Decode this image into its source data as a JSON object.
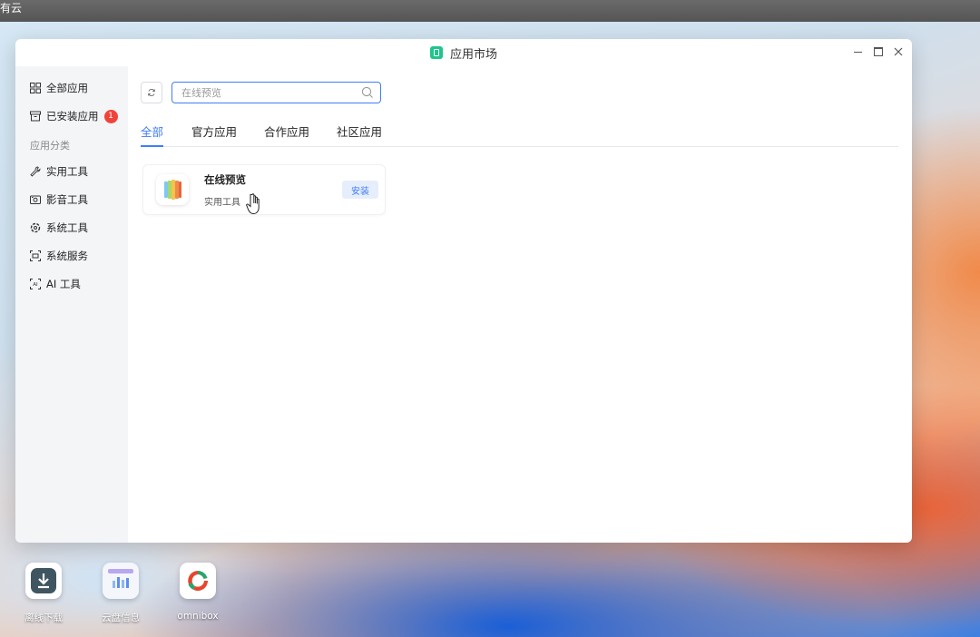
{
  "desktop": {
    "topbar_text": "有云",
    "icons": [
      {
        "label": "离线下载"
      },
      {
        "label": "云盘信息"
      },
      {
        "label": "omnibox"
      }
    ]
  },
  "window": {
    "title": "应用市场"
  },
  "sidebar": {
    "all_apps": "全部应用",
    "installed": "已安装应用",
    "installed_count": "1",
    "category_header": "应用分类",
    "categories": [
      {
        "label": "实用工具",
        "icon": "wrench-icon"
      },
      {
        "label": "影音工具",
        "icon": "media-icon"
      },
      {
        "label": "系统工具",
        "icon": "system-icon"
      },
      {
        "label": "系统服务",
        "icon": "service-icon"
      },
      {
        "label": "AI 工具",
        "icon": "ai-icon"
      }
    ]
  },
  "search": {
    "value": "在线预览",
    "placeholder": "在线预览"
  },
  "tabs": [
    "全部",
    "官方应用",
    "合作应用",
    "社区应用"
  ],
  "app_card": {
    "name": "在线预览",
    "category": "实用工具",
    "install_label": "安装"
  },
  "colors": {
    "accent": "#3f7ef6",
    "badge": "#f0443a",
    "logo": "#1fc58a"
  }
}
